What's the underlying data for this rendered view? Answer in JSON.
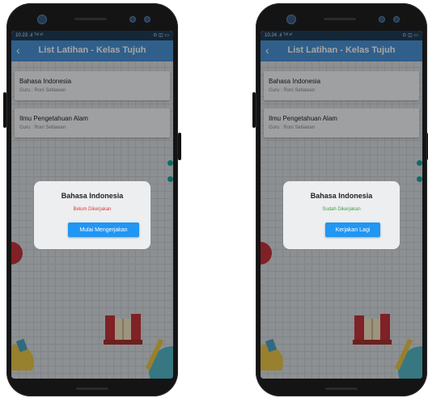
{
  "screens": [
    {
      "status_time": "10.23",
      "status_signal": ".ıl ᵀᵃˡ ᵃˡ",
      "status_icons": "⊙ ◫ ▭",
      "app_title": "List Latihan - Kelas Tujuh",
      "subjects": [
        {
          "name": "Bahasa Indonesia",
          "teacher": "Guru : Roni Setiawan"
        },
        {
          "name": "Ilmu Pengetahuan Alam",
          "teacher": "Guru : Roni Setiawan"
        }
      ],
      "dialog": {
        "title": "Bahasa Indonesia",
        "status": "Belum Dikerjakan",
        "status_color": "#e53935",
        "button_label": "Mulai Mengerjakan"
      }
    },
    {
      "status_time": "10.24",
      "status_signal": ".ıl ᵀᵃˡ ᵃˡ",
      "status_icons": "⊙ ◫ ▭",
      "app_title": "List Latihan - Kelas Tujuh",
      "subjects": [
        {
          "name": "Bahasa Indonesia",
          "teacher": "Guru : Roni Setiawan"
        },
        {
          "name": "Ilmu Pengetahuan Alam",
          "teacher": "Guru : Roni Setiawan"
        }
      ],
      "dialog": {
        "title": "Bahasa Indonesia",
        "status": "Sudah Dikerjakan",
        "status_color": "#43a047",
        "button_label": "Kerjakan Lagi"
      }
    }
  ],
  "icons": {
    "back": "back-arrow-icon"
  },
  "colors": {
    "appbar": "#4a93d6",
    "statusbar": "#203c57",
    "button": "#2196f3"
  }
}
